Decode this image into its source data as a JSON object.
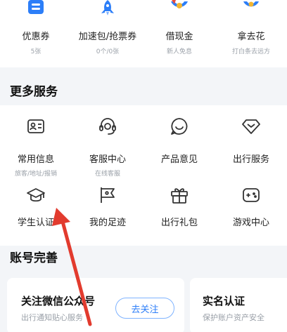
{
  "top_items": [
    {
      "label": "优惠券",
      "sub": "5张",
      "icon": "coupon-icon"
    },
    {
      "label": "加速包/抢票券",
      "sub": "0个/0张",
      "icon": "rocket-icon"
    },
    {
      "label": "借现金",
      "sub": "新人免息",
      "icon": "cash-icon"
    },
    {
      "label": "拿去花",
      "sub": "打白条去远方",
      "icon": "credit-icon"
    }
  ],
  "more_services": {
    "title": "更多服务",
    "items": [
      {
        "label": "常用信息",
        "sub": "旅客/地址/报销",
        "icon": "id-card-icon"
      },
      {
        "label": "客服中心",
        "sub": "在线客服",
        "icon": "headset-icon"
      },
      {
        "label": "产品意见",
        "sub": "",
        "icon": "smile-chat-icon"
      },
      {
        "label": "出行服务",
        "sub": "",
        "icon": "heart-diamond-icon"
      },
      {
        "label": "学生认证",
        "sub": "",
        "icon": "graduation-cap-icon"
      },
      {
        "label": "我的足迹",
        "sub": "",
        "icon": "flag-icon"
      },
      {
        "label": "出行礼包",
        "sub": "",
        "icon": "gift-icon"
      },
      {
        "label": "游戏中心",
        "sub": "",
        "icon": "gamepad-icon"
      }
    ]
  },
  "account": {
    "title": "账号完善",
    "cards": [
      {
        "title": "关注微信公众号",
        "sub": "出行通知贴心服务",
        "button": "去关注"
      },
      {
        "title": "实名认证",
        "sub": "保护账户资产安全"
      }
    ]
  },
  "colors": {
    "accent": "#2c7ef8",
    "annotation_arrow": "#e23b2e"
  }
}
